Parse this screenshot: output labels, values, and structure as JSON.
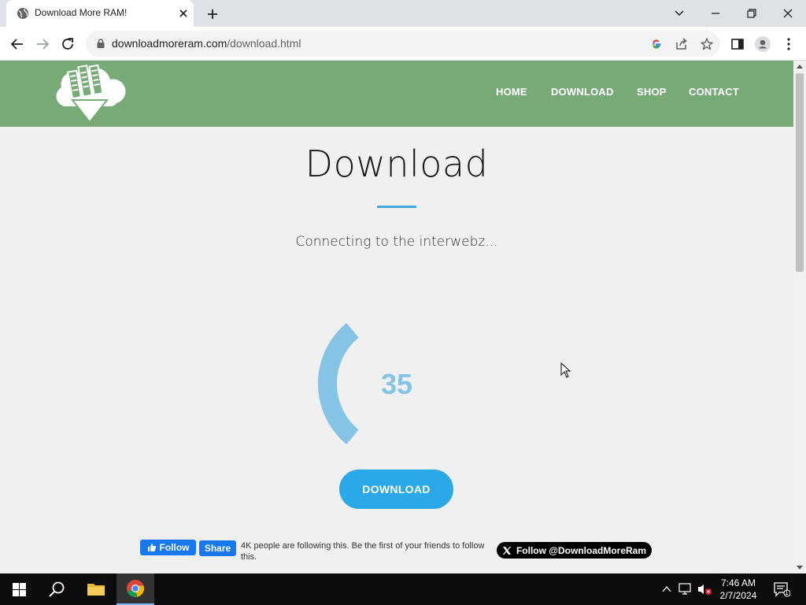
{
  "browser": {
    "tab_title": "Download More RAM!",
    "url_domain": "downloadmoreram.com",
    "url_path": "/download.html"
  },
  "site": {
    "nav": [
      "HOME",
      "DOWNLOAD",
      "SHOP",
      "CONTACT"
    ],
    "brand_color": "#77aa77",
    "accent_color": "#2aa8e7"
  },
  "main": {
    "title": "Download",
    "status": "Connecting to the interwebz...",
    "progress_value": "35",
    "progress_fraction": 0.35,
    "download_label": "DOWNLOAD"
  },
  "social": {
    "fb_follow_label": "Follow",
    "fb_share_label": "Share",
    "fb_text": "4K people are following this. Be the first of your friends to follow this.",
    "twitter_label": "Follow @DownloadMoreRam"
  },
  "taskbar": {
    "time": "7:46 AM",
    "date": "2/7/2024",
    "notification_count": "1"
  }
}
